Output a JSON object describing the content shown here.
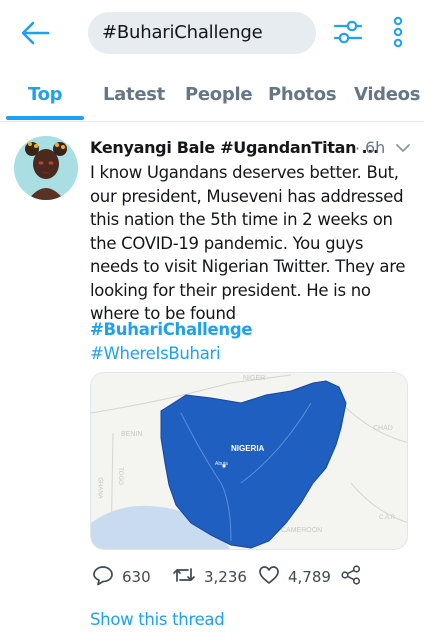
{
  "header": {
    "search_value": "#BuhariChallenge",
    "accent_color": "#1da1f2",
    "back_icon": "back-arrow-icon",
    "filter_icon": "filter-sliders-icon",
    "more_icon": "more-vertical-icon"
  },
  "tabs": [
    {
      "label": "Top",
      "active": true
    },
    {
      "label": "Latest",
      "active": false
    },
    {
      "label": "People",
      "active": false
    },
    {
      "label": "Photos",
      "active": false
    },
    {
      "label": "Videos",
      "active": false
    }
  ],
  "tweet": {
    "author": "Kenyangi Bale #UgandanTitan ...",
    "separator": "·",
    "time": "6h",
    "text": "I know Ugandans deserves better. But, our president, Museveni has addressed this nation the 5th time in 2 weeks on the COVID-19 pandemic. You guys needs to visit Nigerian Twitter. They are looking for their president. He is no where to be found",
    "hashtags": [
      "#BuhariChallenge",
      "#WhereIsBuhari"
    ],
    "map": {
      "country": "NIGERIA",
      "capital": "Abuja",
      "neighbors": [
        "NIGER",
        "CHAD",
        "BENIN",
        "TOGO",
        "GHANA",
        "CAMEROON",
        "C.A.R"
      ],
      "land_color": "#1e5fbf"
    },
    "actions": {
      "replies": "630",
      "retweets": "3,236",
      "likes": "4,789"
    },
    "show_thread": "Show this thread"
  }
}
